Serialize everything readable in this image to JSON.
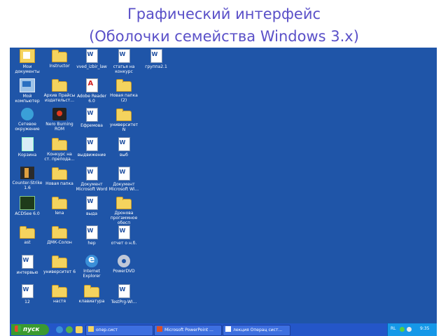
{
  "slide": {
    "title_line1": "Графический интерфейс",
    "title_line2": "(Оболочки семейства Windows 3.x)"
  },
  "desktop": {
    "background": "#1f55a8",
    "icons": [
      {
        "label": "Мои документы",
        "icon": "my-documents-icon"
      },
      {
        "label": "Instructor",
        "icon": "folder-icon"
      },
      {
        "label": "vved_izbir_law",
        "icon": "word-document-icon"
      },
      {
        "label": "статья на конкурс",
        "icon": "word-document-icon"
      },
      {
        "label": "группа2.1",
        "icon": "word-document-icon"
      },
      {
        "label": "Мой компьютер",
        "icon": "my-computer-icon"
      },
      {
        "label": "Архив Прайсы издательст...",
        "icon": "folder-icon"
      },
      {
        "label": "Adobe Reader 6.0",
        "icon": "adobe-reader-icon"
      },
      {
        "label": "Новая папка (2)",
        "icon": "folder-icon"
      },
      {
        "label": "Сетевое окружение",
        "icon": "network-icon"
      },
      {
        "label": "Nero Burning ROM",
        "icon": "nero-icon"
      },
      {
        "label": "Ефремова",
        "icon": "word-document-icon"
      },
      {
        "label": "университет N",
        "icon": "folder-icon"
      },
      {
        "label": "Корзина",
        "icon": "recycle-bin-icon"
      },
      {
        "label": "Конкурс на ст. препода...",
        "icon": "folder-icon"
      },
      {
        "label": "выдвижение",
        "icon": "word-document-icon"
      },
      {
        "label": "выб",
        "icon": "word-document-icon"
      },
      {
        "label": "Counter-Strike 1.6",
        "icon": "counter-strike-icon"
      },
      {
        "label": "Новая папка",
        "icon": "folder-icon"
      },
      {
        "label": "Документ Microsoft Word",
        "icon": "word-document-icon"
      },
      {
        "label": "Документ Microsoft Wi...",
        "icon": "word-document-icon"
      },
      {
        "label": "ACDSee 6.0",
        "icon": "acdsee-icon"
      },
      {
        "label": "lena",
        "icon": "folder-icon"
      },
      {
        "label": "выда",
        "icon": "word-document-icon"
      },
      {
        "label": "Дронова прогаммное обесп",
        "icon": "folder-icon"
      },
      {
        "label": "ast",
        "icon": "folder-icon"
      },
      {
        "label": "ДМК-Солон",
        "icon": "folder-icon"
      },
      {
        "label": "hep",
        "icon": "word-document-icon"
      },
      {
        "label": "отчет о н.б.",
        "icon": "word-document-icon"
      },
      {
        "label": "интервью",
        "icon": "word-document-icon"
      },
      {
        "label": "университет 6",
        "icon": "folder-icon"
      },
      {
        "label": "Internet Explorer",
        "icon": "internet-explorer-icon"
      },
      {
        "label": "PowerDVD",
        "icon": "powerdvd-icon"
      },
      {
        "label": "12",
        "icon": "word-document-icon"
      },
      {
        "label": "настя",
        "icon": "folder-icon"
      },
      {
        "label": "клавиатура",
        "icon": "folder-icon"
      },
      {
        "label": "TestPrg-WI...",
        "icon": "word-document-icon"
      }
    ]
  },
  "taskbar": {
    "start_label": "пуск",
    "tasks": [
      {
        "label": "опер.сист",
        "icon": "folder-icon"
      },
      {
        "label": "Microsoft PowerPoint ...",
        "icon": "powerpoint-icon"
      },
      {
        "label": "лекция Операц сист...",
        "icon": "word-document-icon"
      }
    ],
    "tray": {
      "language": "RL",
      "clock": "9:35"
    }
  }
}
